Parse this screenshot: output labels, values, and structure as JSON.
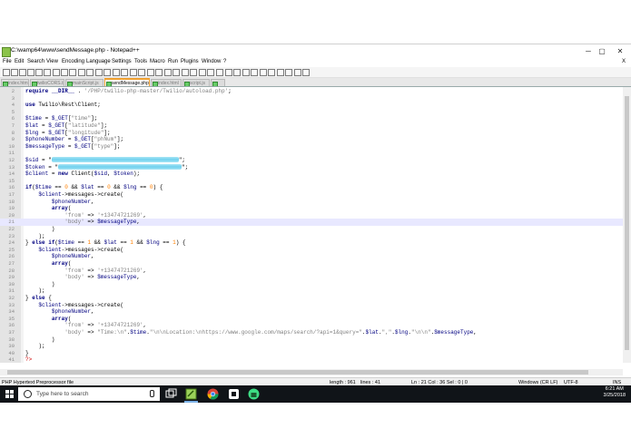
{
  "window": {
    "title": "C:\\wamp64\\www\\sendMessage.php - Notepad++",
    "minimize": "─",
    "maximize": "▢",
    "close": "✕"
  },
  "menu": [
    "File",
    "Edit",
    "Search",
    "View",
    "Encoding",
    "Language",
    "Settings",
    "Tools",
    "Macro",
    "Run",
    "Plugins",
    "Window",
    "?"
  ],
  "menu_close": "X",
  "tabs": [
    {
      "label": "index.html",
      "active": false
    },
    {
      "label": "twilioCORS.txt",
      "active": false
    },
    {
      "label": "mainScript.js",
      "active": false
    },
    {
      "label": "sendMessage.php",
      "active": true
    },
    {
      "label": "index.html",
      "active": false
    },
    {
      "label": "script.js",
      "active": false
    },
    {
      "label": "",
      "active": false
    }
  ],
  "code_lines": [
    {
      "n": "2",
      "t": "require __DIR__ . '/PHP/twilio-php-master/Twilio/autoload.php';"
    },
    {
      "n": "3",
      "t": ""
    },
    {
      "n": "4",
      "t": "use Twilio\\Rest\\Client;"
    },
    {
      "n": "5",
      "t": ""
    },
    {
      "n": "6",
      "t": "$time = $_GET[\"time\"];"
    },
    {
      "n": "7",
      "t": "$lat = $_GET[\"latitude\"];"
    },
    {
      "n": "8",
      "t": "$lng = $_GET[\"longitude\"];"
    },
    {
      "n": "9",
      "t": "$phoneNumber = $_GET[\"phNum\"];"
    },
    {
      "n": "10",
      "t": "$messageType = $_GET[\"type\"];"
    },
    {
      "n": "11",
      "t": ""
    },
    {
      "n": "12",
      "t": "$sid = \"",
      "redact": 140,
      "after": "\";"
    },
    {
      "n": "13",
      "t": "$token = \"",
      "redact": 136,
      "after": "\";"
    },
    {
      "n": "14",
      "t": "$client = new Client($sid, $token);"
    },
    {
      "n": "15",
      "t": ""
    },
    {
      "n": "16",
      "t": "if($time == 0 && $lat == 0 && $lng == 0) {"
    },
    {
      "n": "17",
      "t": "    $client->messages->create("
    },
    {
      "n": "18",
      "t": "        $phoneNumber,"
    },
    {
      "n": "19",
      "t": "        array("
    },
    {
      "n": "20",
      "t": "            'from' => '+13474721269',"
    },
    {
      "n": "21",
      "t": "            'body' => $messageType,",
      "cur": true
    },
    {
      "n": "22",
      "t": "        )"
    },
    {
      "n": "23",
      "t": "    );"
    },
    {
      "n": "24",
      "t": "} else if($time == 1 && $lat == 1 && $lng == 1) {"
    },
    {
      "n": "25",
      "t": "    $client->messages->create("
    },
    {
      "n": "26",
      "t": "        $phoneNumber,"
    },
    {
      "n": "27",
      "t": "        array("
    },
    {
      "n": "28",
      "t": "            'from' => '+13474721269',"
    },
    {
      "n": "29",
      "t": "            'body' => $messageType,"
    },
    {
      "n": "30",
      "t": "        )"
    },
    {
      "n": "31",
      "t": "    );"
    },
    {
      "n": "32",
      "t": "} else {"
    },
    {
      "n": "33",
      "t": "    $client->messages->create("
    },
    {
      "n": "34",
      "t": "        $phoneNumber,"
    },
    {
      "n": "35",
      "t": "        array("
    },
    {
      "n": "36",
      "t": "            'from' => '+13474721269',"
    },
    {
      "n": "37",
      "t": "            'body' => \"Time:\\n\".$time.\"\\n\\nLocation:\\nhttps://www.google.com/maps/search/?api=1&query=\".$lat.\",\".$lng.\"\\n\\n\".$messageType,"
    },
    {
      "n": "38",
      "t": "        )"
    },
    {
      "n": "39",
      "t": "    );"
    },
    {
      "n": "40",
      "t": "}"
    },
    {
      "n": "41",
      "t": "?>"
    }
  ],
  "status": {
    "filetype": "PHP Hypertext Preprocessor file",
    "length": "length : 961",
    "lines": "lines : 41",
    "position": "Ln : 21   Col : 36   Sel : 0 | 0",
    "eol": "Windows (CR LF)",
    "encoding": "UTF-8",
    "mode": "INS"
  },
  "taskbar": {
    "search_placeholder": "Type here to search",
    "time": "6:21 AM",
    "date": "3/25/2018",
    "icons": [
      "task-view-icon",
      "notepadpp-icon",
      "chrome-icon",
      "app-icon",
      "android-icon"
    ]
  },
  "colors": {
    "keyword": "#000080",
    "string": "#808080",
    "number": "#ff8000",
    "active_tab": "#f0a030",
    "redaction": "#6fd0ee",
    "taskbar": "#101418"
  }
}
